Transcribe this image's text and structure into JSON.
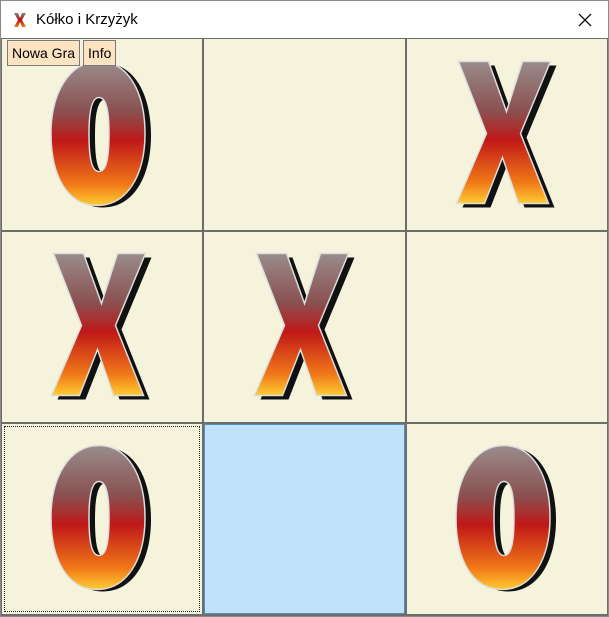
{
  "window": {
    "title": "Kółko i Krzyżyk"
  },
  "icons": {
    "app": "x-app-icon",
    "close": "close-icon"
  },
  "menu": {
    "new_game": "Nowa Gra",
    "info": "Info"
  },
  "board": {
    "cells": [
      "O",
      "",
      "X",
      "X",
      "X",
      "",
      "O",
      "",
      "O"
    ],
    "focused_cell": 6,
    "hovered_cell": 7
  },
  "colors": {
    "cell_background": "#f5f3dc",
    "grid_lines": "#6d6d6d",
    "hover_background": "#c0e3fa",
    "button_background": "#fde3c2",
    "piece_red": "#c01818",
    "piece_orange": "#f07818"
  }
}
